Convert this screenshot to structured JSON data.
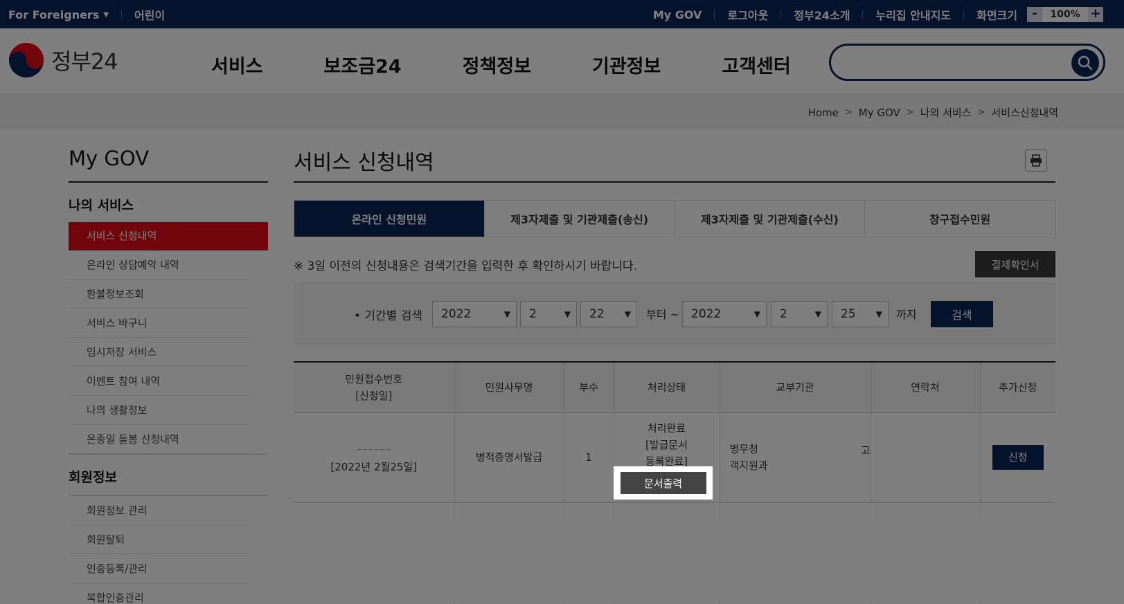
{
  "topbar": {
    "foreigners": "For Foreigners",
    "kids": "어린이",
    "links": [
      "My GOV",
      "로그아웃",
      "정부24소개",
      "누리집 안내지도"
    ],
    "zoom_label": "화면크기",
    "zoom_minus": "-",
    "zoom_value": "100%",
    "zoom_plus": "+"
  },
  "header": {
    "logo_text": "정부24",
    "nav": [
      "서비스",
      "보조금24",
      "정책정보",
      "기관정보",
      "고객센터"
    ],
    "search_placeholder": ""
  },
  "breadcrumb": [
    "Home",
    "My GOV",
    "나의 서비스",
    "서비스신청내역"
  ],
  "sidebar": {
    "title": "My GOV",
    "section1": "나의 서비스",
    "items1": [
      {
        "label": "서비스 신청내역",
        "active": true
      },
      {
        "label": "온라인 상담예약 내역"
      },
      {
        "label": "환불정보조회"
      },
      {
        "label": "서비스 바구니"
      },
      {
        "label": "임시저장 서비스"
      },
      {
        "label": "이벤트 참여 내역"
      },
      {
        "label": "나의 생활정보"
      },
      {
        "label": "온종일 돌봄 신청내역"
      }
    ],
    "section2": "회원정보",
    "items2": [
      {
        "label": "회원정보 관리"
      },
      {
        "label": "회원탈퇴"
      },
      {
        "label": "인증등록/관리"
      },
      {
        "label": "복합인증관리"
      }
    ]
  },
  "main": {
    "title": "서비스 신청내역",
    "tabs": [
      {
        "label": "온라인 신청민원",
        "active": true
      },
      {
        "label": "제3자제출 및 기관제출(송신)"
      },
      {
        "label": "제3자제출 및 기관제출(수신)"
      },
      {
        "label": "창구접수민원"
      }
    ],
    "notice": "※ 3일 이전의 신청내용은 검색기간을 입력한 후 확인하시기 바랍니다.",
    "pay_button": "결제확인서",
    "search": {
      "label": "• 기간별 검색",
      "from_year": "2022",
      "from_month": "2",
      "from_day": "22",
      "from_text": "부터 ~",
      "to_year": "2022",
      "to_month": "2",
      "to_day": "25",
      "to_text": "까지",
      "button": "검색"
    },
    "table": {
      "headers": [
        "민원접수번호",
        "[신청일]",
        "민원사무명",
        "부수",
        "처리상태",
        "교부기관",
        "연락처",
        "추가신청"
      ],
      "row": {
        "receipt_no": "~~~~~~",
        "date": "[2022년 2월25일]",
        "service": "병적증명서발급",
        "copies": "1",
        "status_lines": [
          "처리완료",
          "[발급문서",
          "등록완료]"
        ],
        "print_button": "문서출력",
        "agency_line1": "병무청",
        "agency_line2": "객지원과",
        "agency_trail": "고",
        "contact": "",
        "apply_button": "신청"
      }
    }
  }
}
